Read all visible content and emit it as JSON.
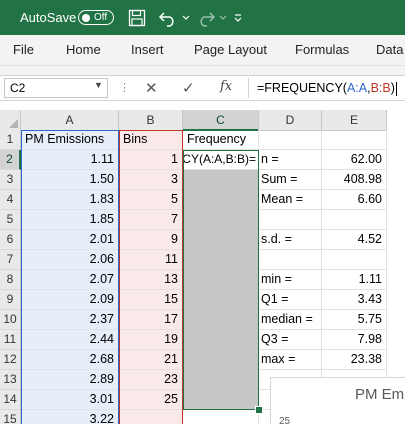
{
  "titlebar": {
    "autosave_label": "AutoSave",
    "autosave_state": "Off",
    "background": "#217346"
  },
  "ribbon": {
    "tabs": [
      "File",
      "Home",
      "Insert",
      "Page Layout",
      "Formulas",
      "Data"
    ]
  },
  "formula_bar": {
    "name_box": "C2",
    "formula_prefix": "=FREQUENCY(",
    "ref_a": "A:A",
    "comma": ",",
    "ref_b": "B:B",
    "formula_suffix": ")"
  },
  "sheet": {
    "columns": [
      "A",
      "B",
      "C",
      "D",
      "E"
    ],
    "selected_column": "C",
    "rows": [
      "1",
      "2",
      "3",
      "4",
      "5",
      "6",
      "7",
      "8",
      "9",
      "10",
      "11",
      "12",
      "13",
      "14",
      "15"
    ],
    "selected_row": "2",
    "headers": {
      "a1": "PM Emissions",
      "b1": "Bins",
      "c1": "Frequency"
    },
    "pm_emissions": [
      "1.11",
      "1.50",
      "1.83",
      "1.85",
      "2.01",
      "2.06",
      "2.07",
      "2.09",
      "2.37",
      "2.44",
      "2.68",
      "2.89",
      "3.01",
      "3.22"
    ],
    "bins": [
      "1",
      "3",
      "5",
      "7",
      "9",
      "11",
      "13",
      "15",
      "17",
      "19",
      "21",
      "23",
      "25",
      ""
    ],
    "c2_editing_text": "=FREQUENCY(A:A,B:B)",
    "stats": [
      {
        "row": "2",
        "label": "n =",
        "value": "62.00"
      },
      {
        "row": "3",
        "label": "Sum =",
        "value": "408.98"
      },
      {
        "row": "4",
        "label": "Mean =",
        "value": "6.60"
      },
      {
        "row": "6",
        "label": "s.d. =",
        "value": "4.52"
      },
      {
        "row": "8",
        "label": "min =",
        "value": "1.11"
      },
      {
        "row": "9",
        "label": "Q1 =",
        "value": "3.43"
      },
      {
        "row": "10",
        "label": "median =",
        "value": "5.75"
      },
      {
        "row": "11",
        "label": "Q3 =",
        "value": "7.98"
      },
      {
        "row": "12",
        "label": "max =",
        "value": "23.38"
      }
    ]
  },
  "chart": {
    "title_visible": "PM Em",
    "y_tick_top": "25"
  },
  "colors": {
    "ref_a": "#2f67c7",
    "ref_b": "#c0392b",
    "selection": "#217346",
    "col_a_fill": "#e6eef9",
    "col_b_fill": "#fae9e9",
    "array_fill": "#c6c6c6"
  }
}
